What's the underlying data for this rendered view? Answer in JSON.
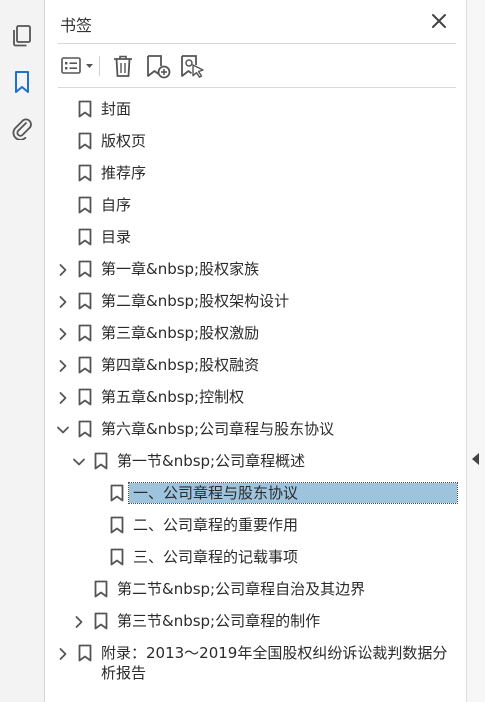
{
  "panel": {
    "title": "书签"
  },
  "rail": {
    "items": [
      {
        "icon": "pages-icon"
      },
      {
        "icon": "bookmark-icon",
        "active": true
      },
      {
        "icon": "attachment-icon"
      }
    ],
    "accent": "#1d6fd1"
  },
  "toolbar": {
    "tools": [
      "options-menu-icon",
      "delete-icon",
      "new-bookmark-icon",
      "new-bookmark-from-structure-icon"
    ]
  },
  "bookmarks": [
    {
      "label": "封面",
      "level": 0,
      "expander": "none"
    },
    {
      "label": "版权页",
      "level": 0,
      "expander": "none"
    },
    {
      "label": "推荐序",
      "level": 0,
      "expander": "none"
    },
    {
      "label": "自序",
      "level": 0,
      "expander": "none"
    },
    {
      "label": "目录",
      "level": 0,
      "expander": "none"
    },
    {
      "label": "第一章&nbsp;股权家族",
      "level": 0,
      "expander": "collapsed"
    },
    {
      "label": "第二章&nbsp;股权架构设计",
      "level": 0,
      "expander": "collapsed"
    },
    {
      "label": "第三章&nbsp;股权激励",
      "level": 0,
      "expander": "collapsed"
    },
    {
      "label": "第四章&nbsp;股权融资",
      "level": 0,
      "expander": "collapsed"
    },
    {
      "label": "第五章&nbsp;控制权",
      "level": 0,
      "expander": "collapsed"
    },
    {
      "label": "第六章&nbsp;公司章程与股东协议",
      "level": 0,
      "expander": "expanded"
    },
    {
      "label": "第一节&nbsp;公司章程概述",
      "level": 1,
      "expander": "expanded"
    },
    {
      "label": "一、公司章程与股东协议",
      "level": 2,
      "expander": "none",
      "selected": true
    },
    {
      "label": "二、公司章程的重要作用",
      "level": 2,
      "expander": "none"
    },
    {
      "label": "三、公司章程的记载事项",
      "level": 2,
      "expander": "none"
    },
    {
      "label": "第二节&nbsp;公司章程自治及其边界",
      "level": 1,
      "expander": "none"
    },
    {
      "label": "第三节&nbsp;公司章程的制作",
      "level": 1,
      "expander": "collapsed"
    },
    {
      "label": "附录：2013～2019年全国股权纠纷诉讼裁判数据分析报告",
      "level": 0,
      "expander": "collapsed"
    }
  ],
  "colors": {
    "selection": "#9ec3dd",
    "icon": "#555555"
  }
}
